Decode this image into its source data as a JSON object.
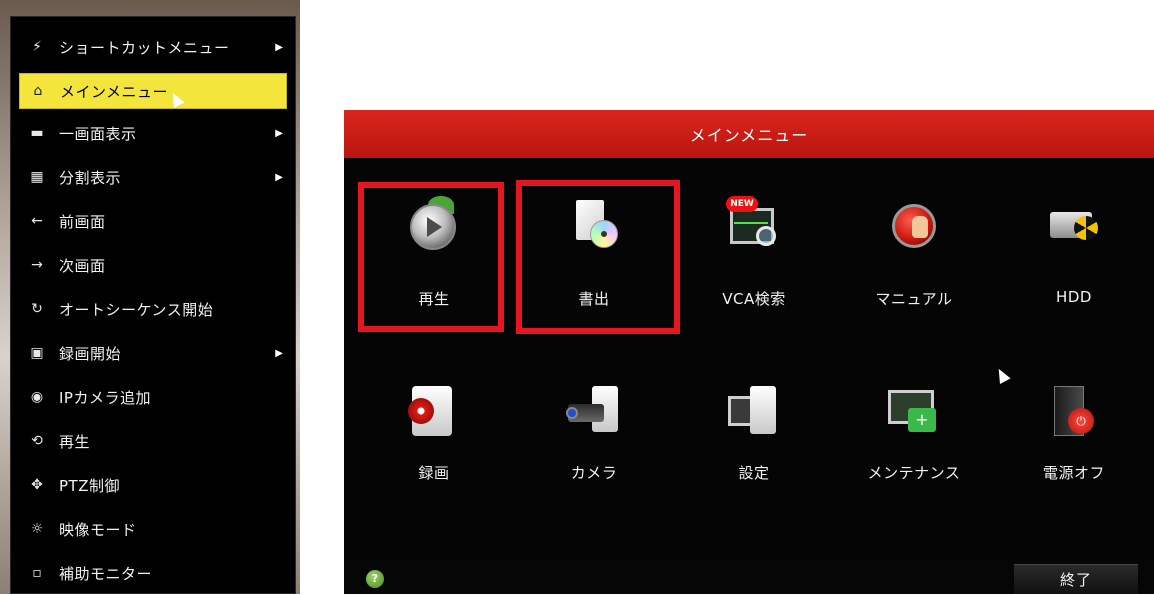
{
  "context_menu": {
    "items": [
      {
        "label": "ショートカットメニュー",
        "icon": "shortcut-icon",
        "glyph": "⚡",
        "arrow": true,
        "active": false
      },
      {
        "label": "メインメニュー",
        "icon": "home-icon",
        "glyph": "⌂",
        "arrow": false,
        "active": true
      },
      {
        "label": "一画面表示",
        "icon": "camera-icon",
        "glyph": "▬",
        "arrow": true,
        "active": false
      },
      {
        "label": "分割表示",
        "icon": "grid-icon",
        "glyph": "▦",
        "arrow": true,
        "active": false
      },
      {
        "label": "前画面",
        "icon": "arrow-left-icon",
        "glyph": "←",
        "arrow": false,
        "active": false
      },
      {
        "label": "次画面",
        "icon": "arrow-right-icon",
        "glyph": "→",
        "arrow": false,
        "active": false
      },
      {
        "label": "オートシーケンス開始",
        "icon": "refresh-icon",
        "glyph": "↻",
        "arrow": false,
        "active": false
      },
      {
        "label": "録画開始",
        "icon": "record-icon",
        "glyph": "▣",
        "arrow": true,
        "active": false
      },
      {
        "label": "IPカメラ追加",
        "icon": "ip-camera-icon",
        "glyph": "◉",
        "arrow": false,
        "active": false
      },
      {
        "label": "再生",
        "icon": "playback-icon",
        "glyph": "⟲",
        "arrow": false,
        "active": false
      },
      {
        "label": "PTZ制御",
        "icon": "ptz-icon",
        "glyph": "✥",
        "arrow": false,
        "active": false
      },
      {
        "label": "映像モード",
        "icon": "video-mode-icon",
        "glyph": "☼",
        "arrow": false,
        "active": false
      },
      {
        "label": "補助モニター",
        "icon": "aux-monitor-icon",
        "glyph": "▫",
        "arrow": false,
        "active": false
      }
    ]
  },
  "main_menu": {
    "title": "メインメニュー",
    "tiles": [
      {
        "label": "再生",
        "icon": "playback-icon",
        "highlighted": true
      },
      {
        "label": "書出",
        "icon": "export-icon",
        "highlighted": true
      },
      {
        "label": "VCA検索",
        "icon": "vca-search-icon",
        "badge": "NEW",
        "highlighted": false
      },
      {
        "label": "マニュアル",
        "icon": "manual-icon",
        "highlighted": false
      },
      {
        "label": "HDD",
        "icon": "hdd-icon",
        "highlighted": false
      },
      {
        "label": "録画",
        "icon": "record-icon",
        "highlighted": false
      },
      {
        "label": "カメラ",
        "icon": "camera-icon",
        "highlighted": false
      },
      {
        "label": "設定",
        "icon": "settings-icon",
        "highlighted": false
      },
      {
        "label": "メンテナンス",
        "icon": "maintenance-icon",
        "highlighted": false
      },
      {
        "label": "電源オフ",
        "icon": "power-off-icon",
        "highlighted": false
      }
    ],
    "footer": {
      "help_glyph": "?",
      "exit_label": "終了"
    }
  },
  "colors": {
    "accent_red": "#d8261d",
    "highlight_yellow": "#f3e53c",
    "annotation_red": "#e4161f"
  }
}
